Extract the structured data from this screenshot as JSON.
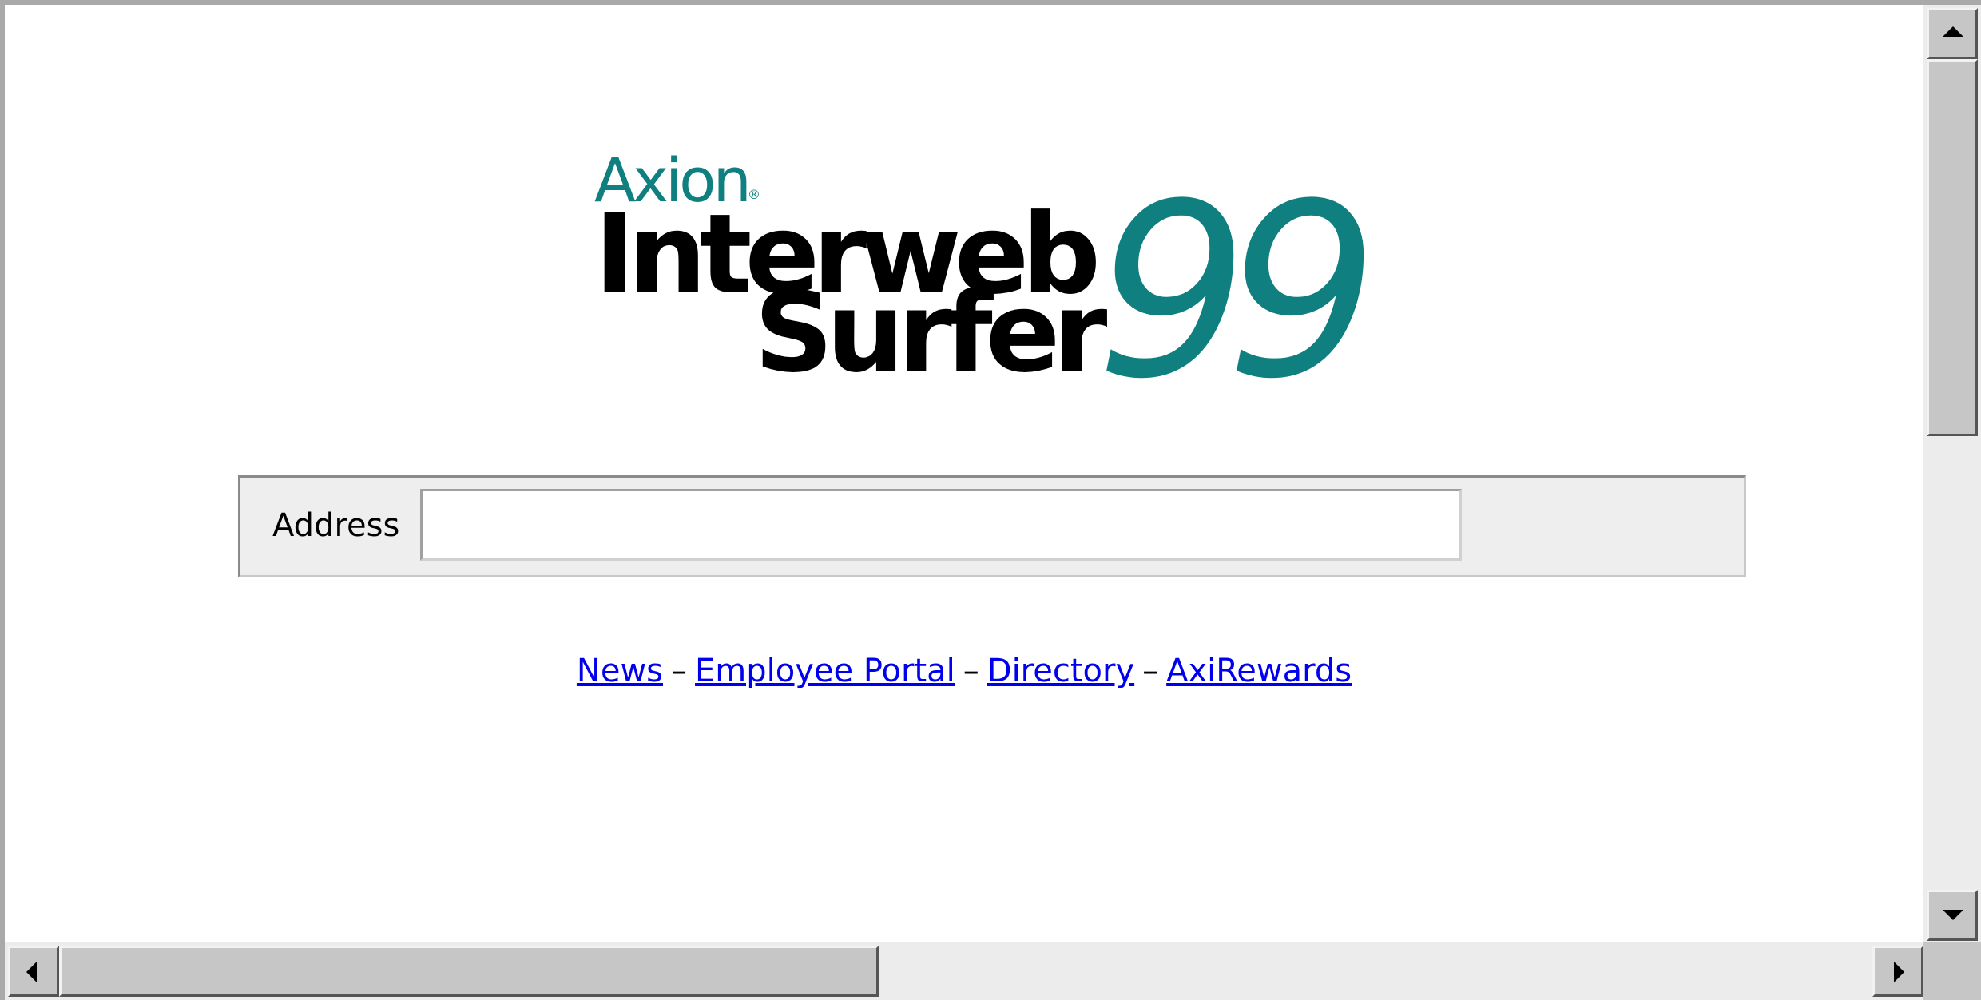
{
  "logo": {
    "brand": "Axion",
    "registered_mark": "®",
    "line1": "Interweb",
    "line2": "Surfer",
    "version": "99",
    "accent_color": "#0f7f7f"
  },
  "address_bar": {
    "label": "Address",
    "value": "",
    "placeholder": ""
  },
  "links": {
    "news": "News",
    "employee_portal": "Employee Portal",
    "directory": "Directory",
    "axirewards": "AxiRewards",
    "separator": "–"
  },
  "scrollbars": {
    "vertical": {
      "up_icon": "arrow-up-icon",
      "down_icon": "arrow-down-icon"
    },
    "horizontal": {
      "left_icon": "arrow-left-icon",
      "right_icon": "arrow-right-icon"
    }
  }
}
